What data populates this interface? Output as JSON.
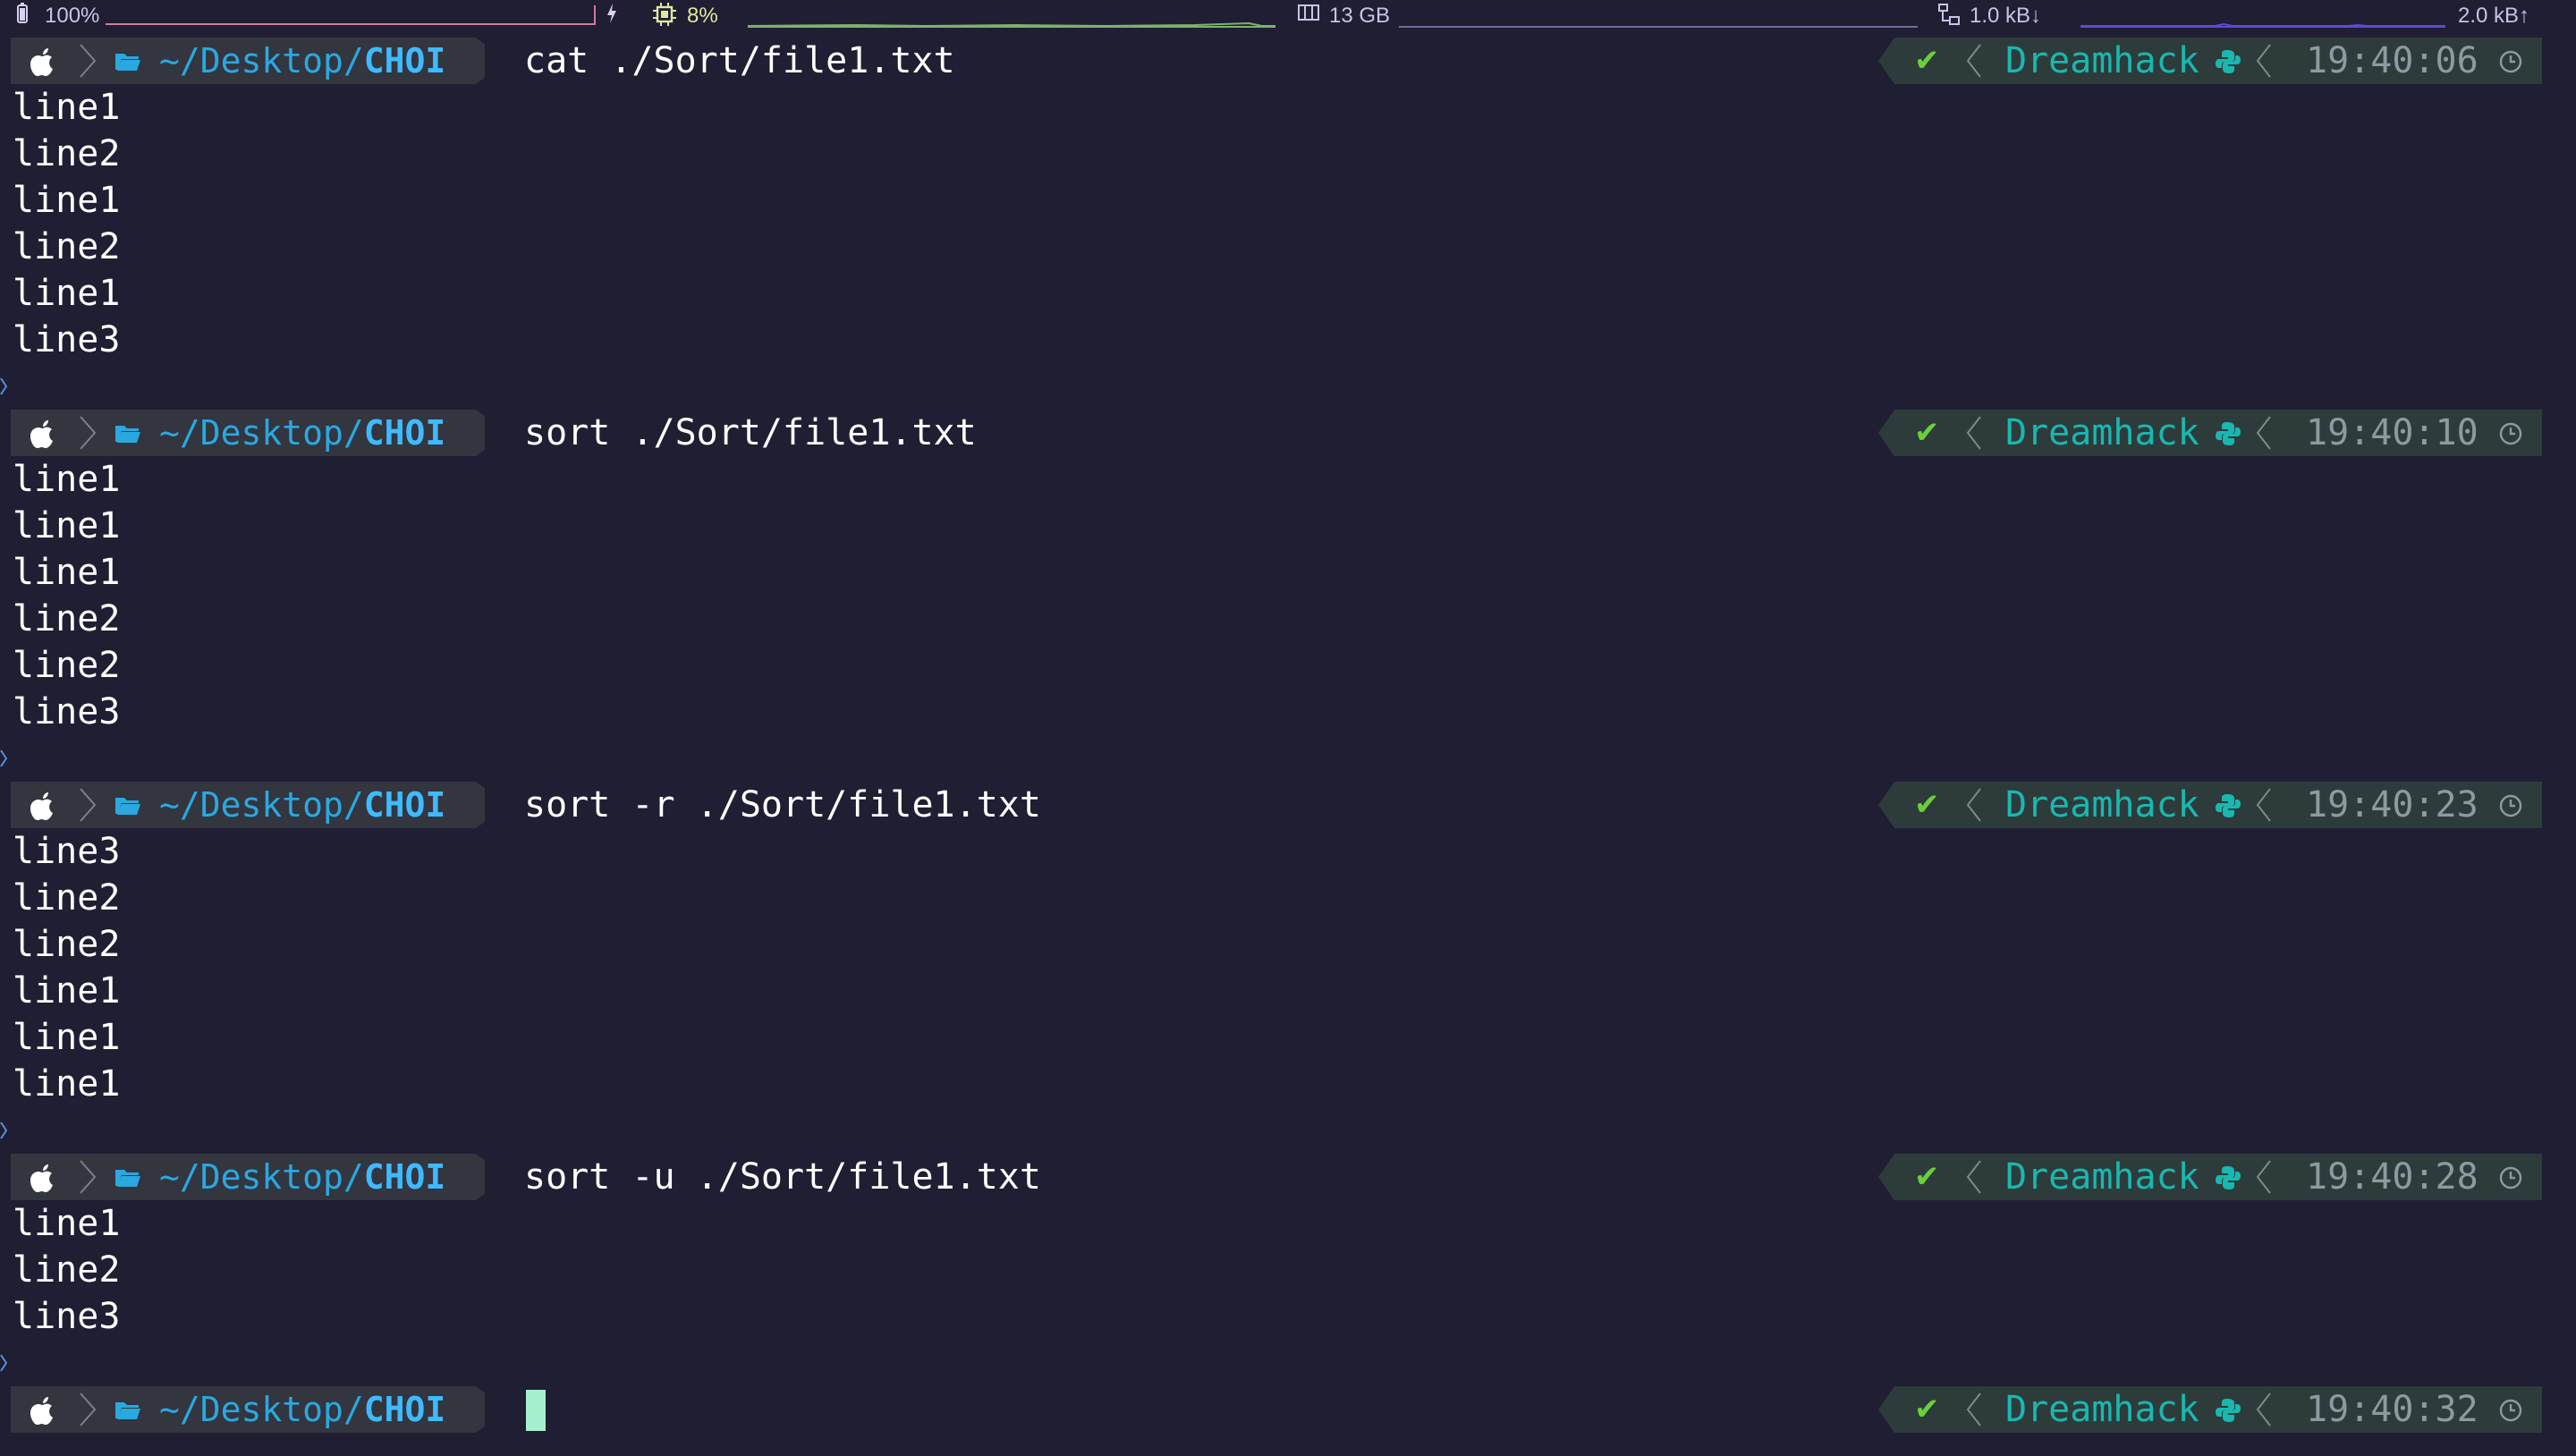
{
  "statusbar": {
    "battery": "100%",
    "battery_level": 1.0,
    "cpu": "8%",
    "memory": "13 GB",
    "net_down": "1.0 kB↓",
    "net_up": "2.0 kB↑",
    "icons": [
      "battery-icon",
      "bolt-icon",
      "cpu-icon",
      "memory-icon",
      "network-icon"
    ]
  },
  "prompt": {
    "path_prefix": "~/Desktop/",
    "path_dir": "CHOI",
    "env": "Dreamhack",
    "status_icon": "✔",
    "icons": [
      "apple-icon",
      "folder-icon",
      "check-icon",
      "python-icon",
      "clock-icon"
    ]
  },
  "colors": {
    "background": "#1f1e33",
    "path": "#2aa8e0",
    "env": "#18b8b0",
    "check": "#6ad03a",
    "cursor": "#a6f0cf"
  },
  "blocks": [
    {
      "command": "cat ./Sort/file1.txt",
      "time": "19:40:06",
      "output": [
        "line1",
        "line2",
        "line1",
        "line2",
        "line1",
        "line3"
      ]
    },
    {
      "command": "sort ./Sort/file1.txt",
      "time": "19:40:10",
      "output": [
        "line1",
        "line1",
        "line1",
        "line2",
        "line2",
        "line3"
      ]
    },
    {
      "command": "sort -r ./Sort/file1.txt",
      "time": "19:40:23",
      "output": [
        "line3",
        "line2",
        "line2",
        "line1",
        "line1",
        "line1"
      ]
    },
    {
      "command": "sort -u ./Sort/file1.txt",
      "time": "19:40:28",
      "output": [
        "line1",
        "line2",
        "line3"
      ]
    }
  ],
  "current": {
    "command": "",
    "time": "19:40:32"
  }
}
